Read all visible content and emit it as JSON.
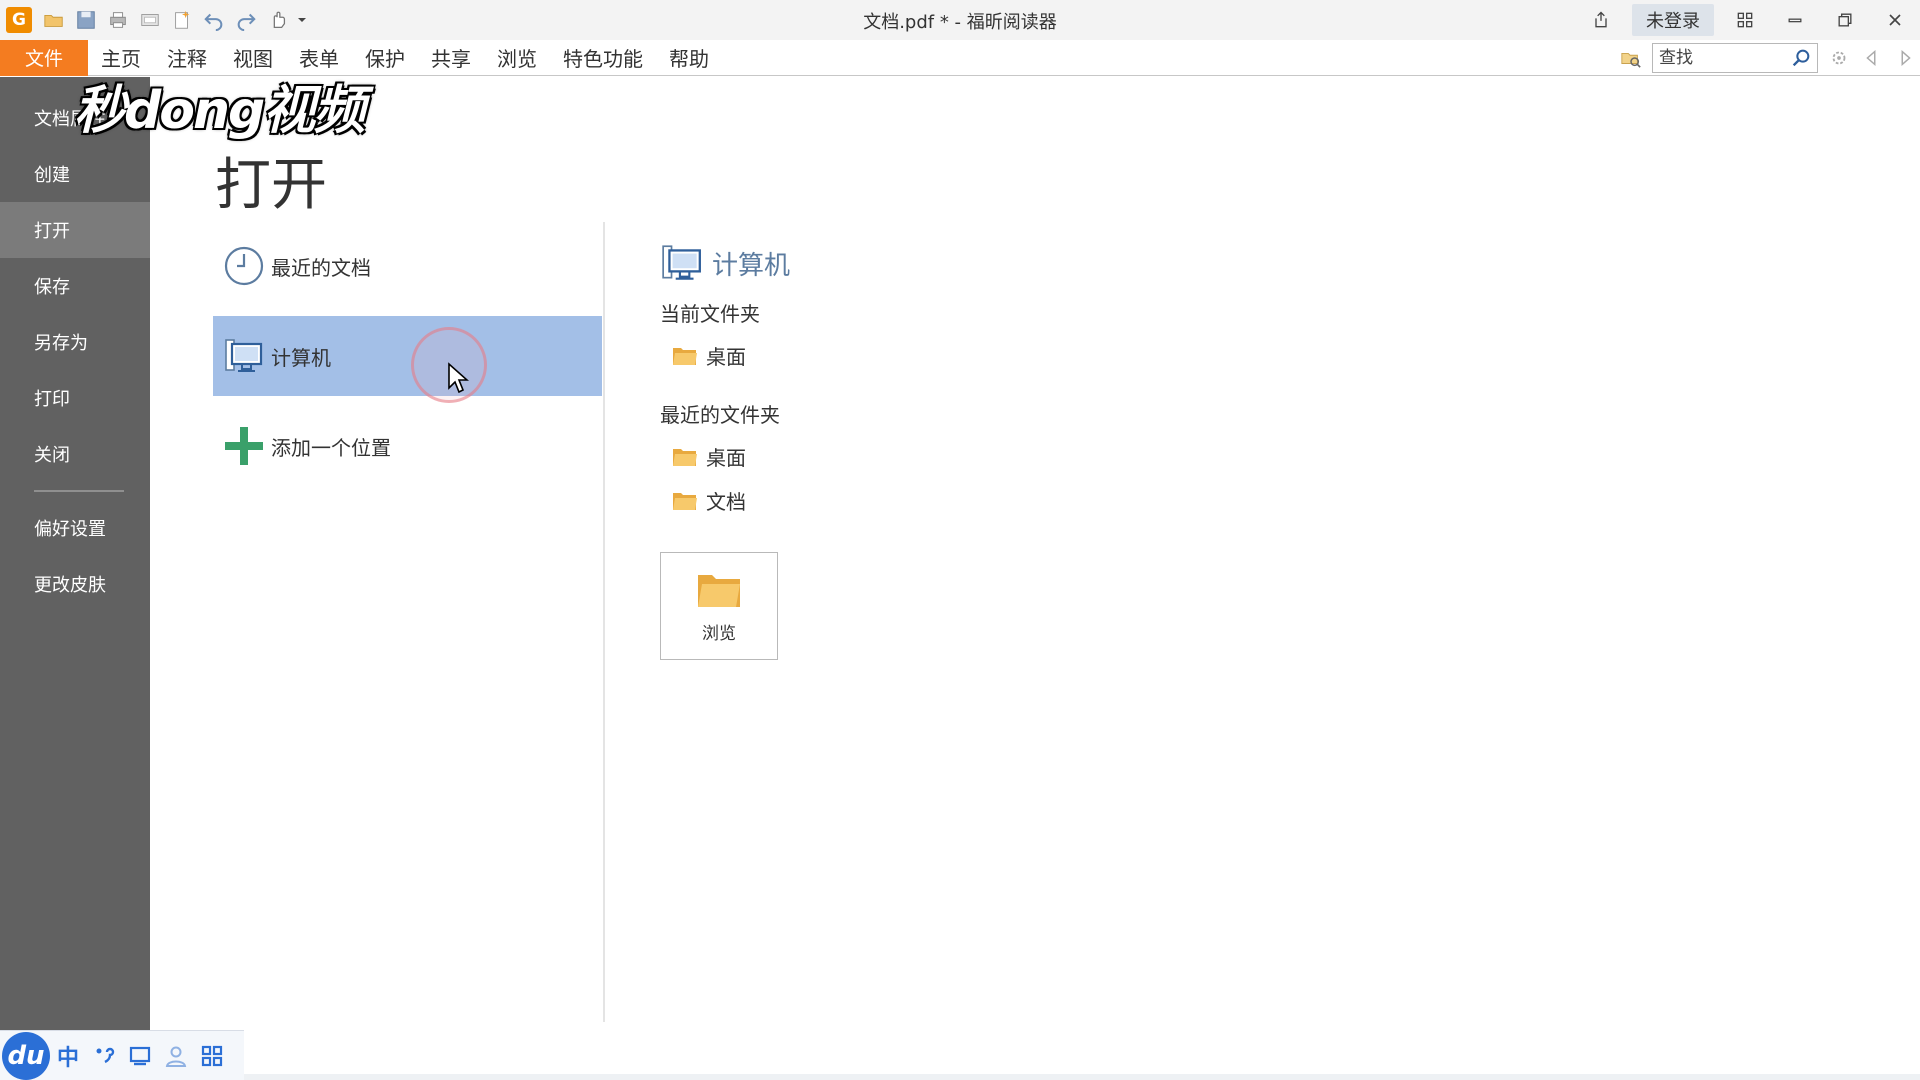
{
  "window": {
    "title": "文档.pdf * - 福昕阅读器",
    "login_label": "未登录",
    "app_icon_letter": "G"
  },
  "menu": {
    "file_label": "文件",
    "items": [
      "主页",
      "注释",
      "视图",
      "表单",
      "保护",
      "共享",
      "浏览",
      "特色功能",
      "帮助"
    ],
    "search_placeholder": "查找"
  },
  "sidebar": {
    "items": [
      "文档属性",
      "创建",
      "打开",
      "保存",
      "另存为",
      "打印",
      "关闭"
    ],
    "active": "打开",
    "bottom_items": [
      "偏好设置",
      "更改皮肤"
    ]
  },
  "watermark": "秒dong视频",
  "main": {
    "title": "打开",
    "places": [
      {
        "label": "最近的文档",
        "icon": "clock-icon"
      },
      {
        "label": "计算机",
        "icon": "computer-icon"
      },
      {
        "label": "添加一个位置",
        "icon": "plus-icon"
      }
    ],
    "selected_place": "计算机"
  },
  "detail": {
    "heading": "计算机",
    "current_folder_label": "当前文件夹",
    "current_folders": [
      "桌面"
    ],
    "recent_folder_label": "最近的文件夹",
    "recent_folders": [
      "桌面",
      "文档"
    ],
    "browse_label": "浏览"
  },
  "ime": {
    "logo": "du",
    "mode": "中"
  },
  "colors": {
    "accent_orange": "#f47c20",
    "sidebar_bg": "#616161",
    "selected_bg": "#a3bfe7",
    "heading_blue": "#5c7ca0"
  }
}
